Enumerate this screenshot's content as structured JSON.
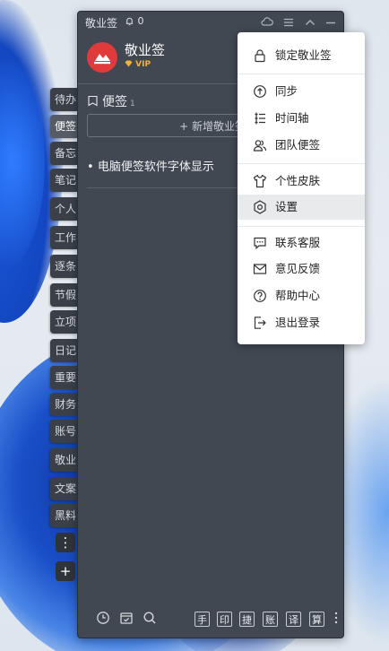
{
  "window": {
    "title": "敬业签",
    "notification_count": "0",
    "app_name": "敬业签",
    "vip_label": "VIP"
  },
  "side_tabs": [
    "待办",
    "便签",
    "备忘",
    "笔记",
    "个人",
    "工作",
    "逐条",
    "节假",
    "立项",
    "日记",
    "重要",
    "财务",
    "账号",
    "敬业",
    "文案",
    "黑料"
  ],
  "side_tab_active_index": 1,
  "side_buttons": {
    "more": "⋮",
    "add": "+"
  },
  "notes_panel": {
    "title": "便签",
    "count": "1",
    "new_button": "+ 新增敬业签",
    "items": [
      "电脑便签软件字体显示"
    ]
  },
  "bottom_bar": {
    "boxes": [
      "手",
      "印",
      "捷",
      "账",
      "译",
      "算"
    ]
  },
  "menu": {
    "items": [
      {
        "label": "锁定敬业签",
        "icon": "lock-icon"
      },
      {
        "label": "同步",
        "icon": "sync-icon"
      },
      {
        "label": "时间轴",
        "icon": "timeline-icon"
      },
      {
        "label": "团队便签",
        "icon": "team-icon"
      },
      {
        "label": "个性皮肤",
        "icon": "skin-icon"
      },
      {
        "label": "设置",
        "icon": "settings-icon",
        "highlighted": true
      },
      {
        "label": "联系客服",
        "icon": "chat-icon"
      },
      {
        "label": "意见反馈",
        "icon": "mail-icon"
      },
      {
        "label": "帮助中心",
        "icon": "help-icon"
      },
      {
        "label": "退出登录",
        "icon": "logout-icon"
      }
    ]
  },
  "colors": {
    "app_bg": "#414852",
    "brand_red": "#e03a3a",
    "vip_gold": "#f1b13b",
    "menu_bg": "#ffffff",
    "menu_highlight": "#e9eaec"
  }
}
